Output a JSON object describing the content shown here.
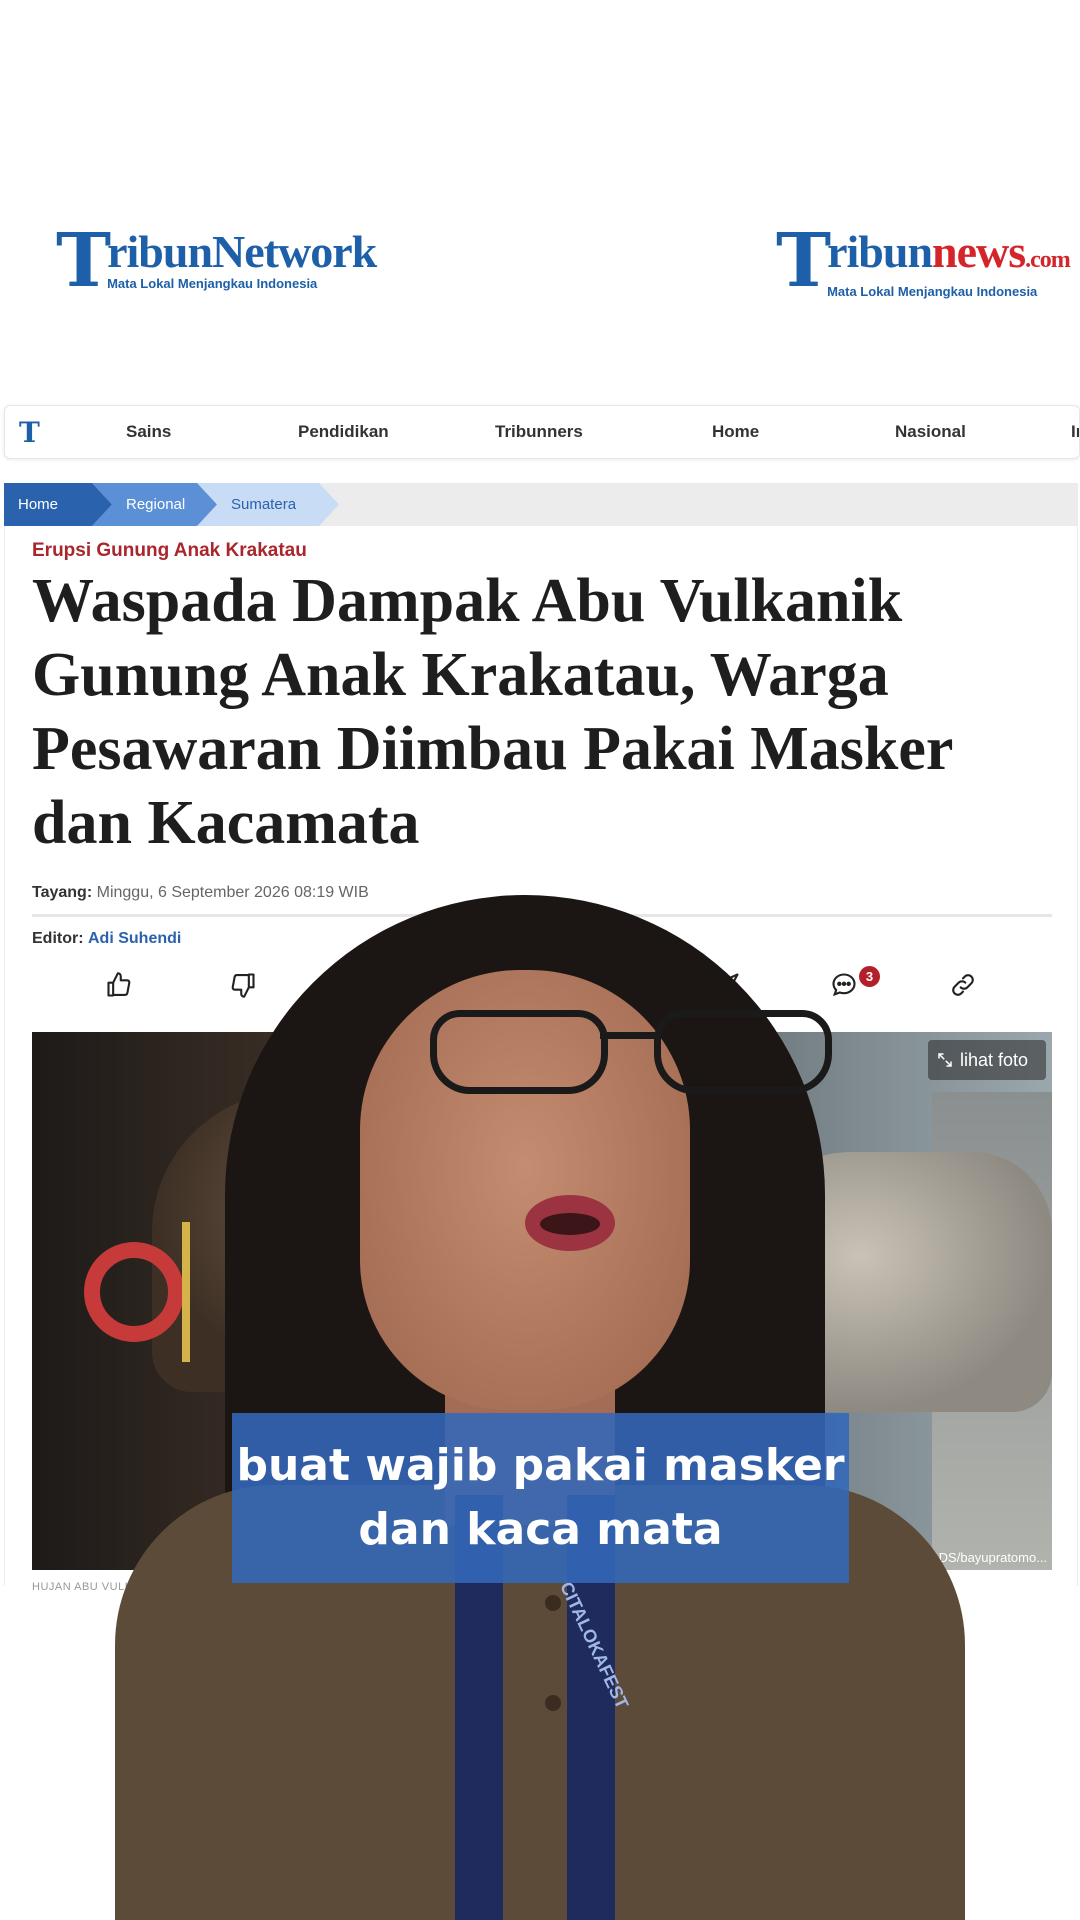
{
  "header": {
    "logo_left": {
      "initial": "T",
      "name": "ribunNetwork",
      "tagline": "Mata Lokal Menjangkau Indonesia"
    },
    "logo_right": {
      "initial": "T",
      "name_blue": "ribun",
      "name_red": "news",
      "name_suffix": ".com",
      "tagline": "Mata Lokal Menjangkau Indonesia"
    }
  },
  "nav": {
    "logo": "T",
    "items": [
      "Sains",
      "Pendidikan",
      "Tribunners",
      "Home",
      "Nasional",
      "In"
    ]
  },
  "breadcrumb": [
    "Home",
    "Regional",
    "Sumatera"
  ],
  "article": {
    "kicker": "Erupsi Gunung Anak Krakatau",
    "headline": "Waspada Dampak Abu Vulkanik Gunung Anak Krakatau, Warga Pesawaran Diimbau Pakai Masker dan Kacamata",
    "published_label": "Tayang:",
    "published_value": "Minggu, 6 September 2026 08:19 WIB",
    "editor_label": "Editor:",
    "editor_name": "Adi Suhendi",
    "comment_count": "3",
    "photo_button": "lihat foto",
    "photo_credit": "ADS/bayupratomo...",
    "photo_caption": "HUJAN ABU VULKAN..."
  },
  "share_icons": [
    "thumbs-up-icon",
    "thumbs-down-icon",
    "x-icon",
    "telegram-icon",
    "comment-icon",
    "link-icon"
  ],
  "overlay": {
    "subtitle": "buat wajib pakai masker\ndan kaca mata",
    "lanyard_text": "CITALOKAFEST"
  },
  "colors": {
    "brand_blue": "#1d5fa8",
    "brand_red": "#d4252a",
    "kicker_red": "#a8262c",
    "subtitle_bg": "#3368ba"
  }
}
